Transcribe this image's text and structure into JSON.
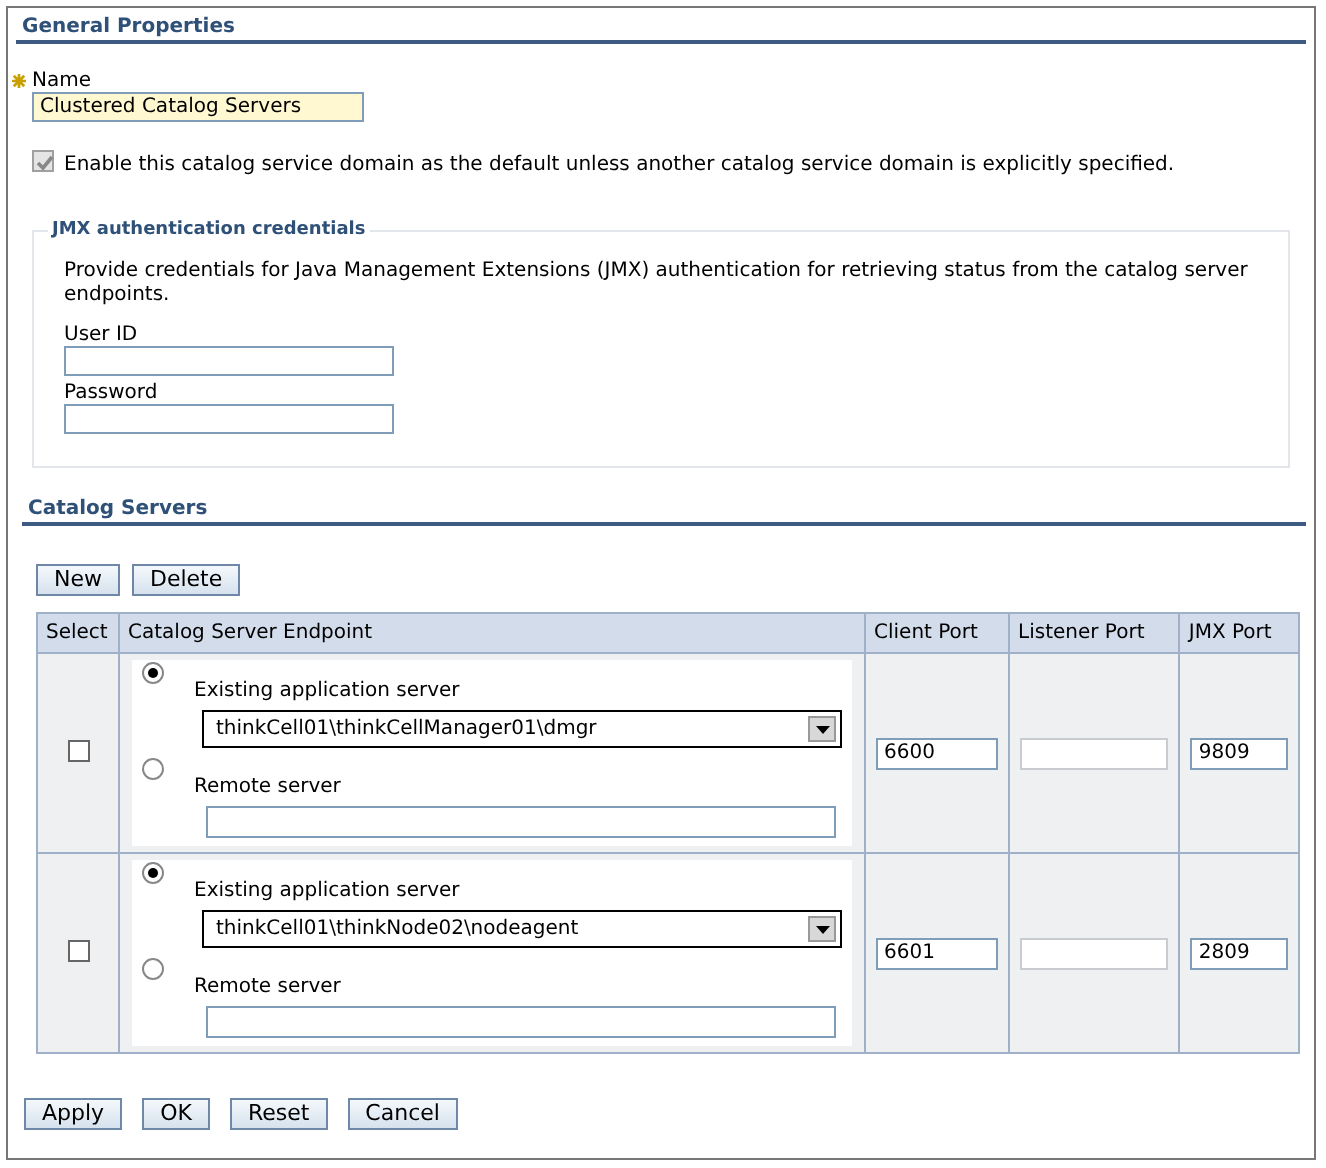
{
  "general_properties": {
    "heading": "General Properties",
    "name_field": {
      "label": "Name",
      "required": true,
      "value": "Clustered Catalog Servers"
    },
    "default_domain": {
      "label": "Enable this catalog service domain as the default unless another catalog service domain is explicitly specified.",
      "checked": true,
      "disabled": true
    }
  },
  "jmx_credentials": {
    "legend": "JMX authentication credentials",
    "description": "Provide credentials for Java Management Extensions (JMX) authentication for retrieving status from the catalog server endpoints.",
    "fields": [
      {
        "label": "User ID"
      },
      {
        "label": "Password"
      }
    ]
  },
  "catalog_servers": {
    "heading": "Catalog Servers",
    "toolbar_buttons": [
      "New",
      "Delete"
    ],
    "columns": [
      "Select",
      "Catalog Server Endpoint",
      "Client Port",
      "Listener Port",
      "JMX Port"
    ],
    "rows": [
      {
        "checked": false,
        "options": [
          {
            "kind": "existing",
            "label": "Existing application server",
            "selected": true,
            "value": "thinkCell01\\thinkCellManager01\\dmgr"
          },
          {
            "kind": "remote",
            "label": "Remote server",
            "selected": false
          }
        ],
        "client_port": "6600",
        "jmx_port": "9809"
      },
      {
        "checked": false,
        "options": [
          {
            "kind": "existing",
            "label": "Existing application server",
            "selected": true,
            "value": "thinkCell01\\thinkNode02\\nodeagent"
          },
          {
            "kind": "remote",
            "label": "Remote server",
            "selected": false
          }
        ],
        "client_port": "6601",
        "jmx_port": "2809"
      }
    ]
  },
  "buttons": [
    "Apply",
    "OK",
    "Reset",
    "Cancel"
  ]
}
